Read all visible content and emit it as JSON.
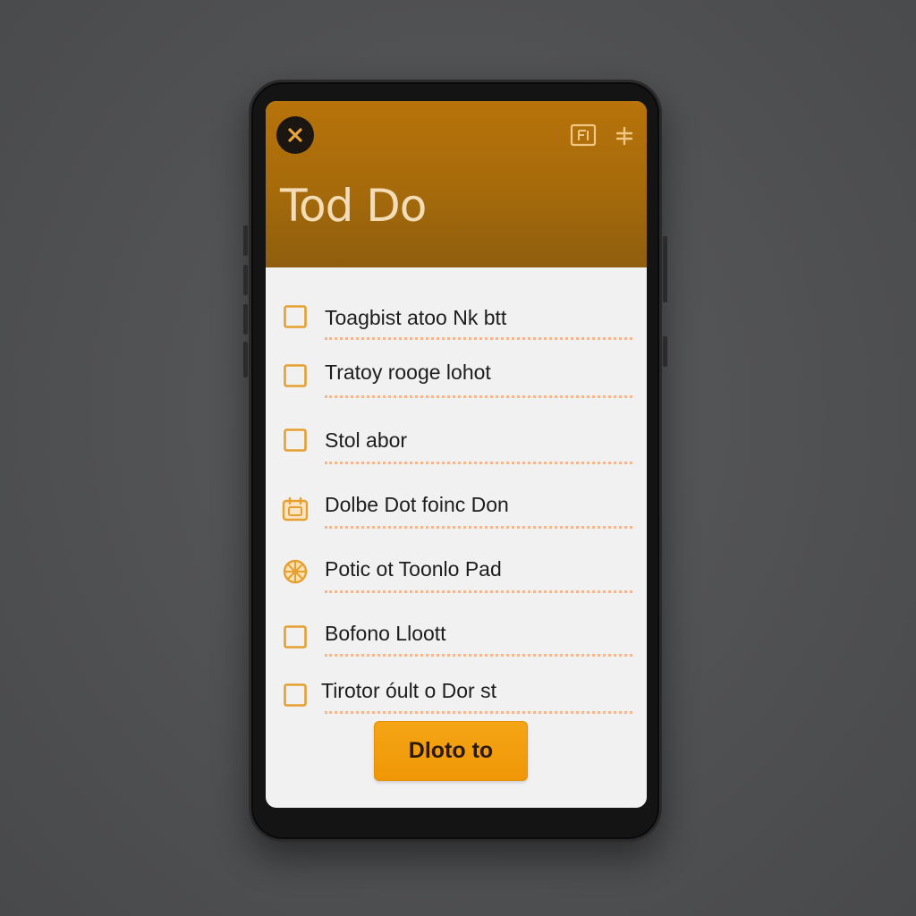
{
  "app": {
    "title": "Tod Do"
  },
  "header": {
    "close_icon": "close-icon",
    "right_icons": [
      "note-icon",
      "plus-icon"
    ]
  },
  "tasks": [
    {
      "label": "Toagbist atoo Nk btt",
      "icon": "checkbox-empty",
      "checked": false
    },
    {
      "label": "Tratoy rooge lohot",
      "icon": "checkbox-empty",
      "checked": false
    },
    {
      "label": "Stol abor",
      "icon": "checkbox-empty",
      "checked": false
    },
    {
      "label": "Dolbe Dot foinc Don",
      "icon": "calendar-icon",
      "checked": false
    },
    {
      "label": "Potic ot Toonlo Pad",
      "icon": "pizza-icon",
      "checked": false
    },
    {
      "label": "Bofono Lloott",
      "icon": "checkbox-empty",
      "checked": false
    },
    {
      "label": "Tirotor óult o Dor st",
      "icon": "checkbox-empty",
      "checked": false
    }
  ],
  "action_button": {
    "label": "Dloto to"
  },
  "colors": {
    "accent": "#b8730a",
    "checkbox": "#e6a030",
    "button": "#f29e0c",
    "dotted_rule": "#f2b78e",
    "background": "#505153"
  }
}
